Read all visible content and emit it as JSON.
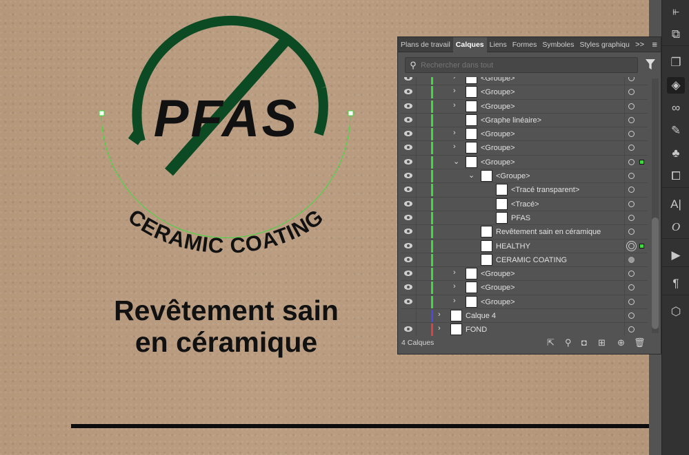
{
  "artwork": {
    "logo_text": "PFAS",
    "arc_text": "CERAMIC COATING",
    "headline_line1": "Revêtement sain",
    "headline_line2": "en céramique",
    "brand_green": "#0b4a23",
    "selection_color": "#3ddc3d"
  },
  "panel": {
    "tabs": [
      {
        "label": "Plans de travail"
      },
      {
        "label": "Calques",
        "active": true
      },
      {
        "label": "Liens"
      },
      {
        "label": "Formes"
      },
      {
        "label": "Symboles"
      },
      {
        "label": "Styles graphiqu"
      }
    ],
    "more_label": ">>",
    "search_placeholder": "Rechercher dans tout",
    "layers": [
      {
        "name": "<Groupe>",
        "level": 1,
        "expander": "collapsed",
        "visible": true,
        "color": "#3ddc3d"
      },
      {
        "name": "<Groupe>",
        "level": 1,
        "expander": "collapsed",
        "visible": true,
        "color": "#3ddc3d"
      },
      {
        "name": "<Groupe>",
        "level": 1,
        "expander": "collapsed",
        "visible": true,
        "color": "#3ddc3d"
      },
      {
        "name": "<Graphe linéaire>",
        "level": 1,
        "expander": "none",
        "visible": true,
        "color": "#3ddc3d"
      },
      {
        "name": "<Groupe>",
        "level": 1,
        "expander": "collapsed",
        "visible": true,
        "color": "#3ddc3d"
      },
      {
        "name": "<Groupe>",
        "level": 1,
        "expander": "collapsed",
        "visible": true,
        "color": "#3ddc3d"
      },
      {
        "name": "<Groupe>",
        "level": 1,
        "expander": "expanded",
        "visible": true,
        "color": "#3ddc3d",
        "selected": true
      },
      {
        "name": "<Groupe>",
        "level": 2,
        "expander": "expanded",
        "visible": true,
        "color": "#3ddc3d"
      },
      {
        "name": "<Tracé transparent>",
        "level": 3,
        "expander": "none",
        "visible": true,
        "color": "#3ddc3d"
      },
      {
        "name": "<Tracé>",
        "level": 3,
        "expander": "none",
        "visible": true,
        "color": "#3ddc3d"
      },
      {
        "name": "PFAS",
        "level": 3,
        "expander": "none",
        "visible": true,
        "color": "#3ddc3d"
      },
      {
        "name": "Revêtement sain en céramique",
        "level": 2,
        "expander": "none",
        "visible": true,
        "color": "#3ddc3d"
      },
      {
        "name": "HEALTHY",
        "level": 2,
        "expander": "none",
        "visible": true,
        "color": "#3ddc3d",
        "target": "double",
        "selected": true
      },
      {
        "name": "CERAMIC COATING",
        "level": 2,
        "expander": "none",
        "visible": true,
        "color": "#3ddc3d",
        "target": "filled"
      },
      {
        "name": "<Groupe>",
        "level": 1,
        "expander": "collapsed",
        "visible": true,
        "color": "#3ddc3d"
      },
      {
        "name": "<Groupe>",
        "level": 1,
        "expander": "collapsed",
        "visible": true,
        "color": "#3ddc3d"
      },
      {
        "name": "<Groupe>",
        "level": 1,
        "expander": "collapsed",
        "visible": true,
        "color": "#3ddc3d"
      },
      {
        "name": "Calque 4",
        "level": 0,
        "expander": "collapsed",
        "visible": false,
        "color": "#4a4ae0"
      },
      {
        "name": "FOND",
        "level": 0,
        "expander": "collapsed",
        "visible": true,
        "color": "#e04040"
      }
    ],
    "footer_count": "4 Calques"
  },
  "toolbar": {
    "icons": [
      "align-icon",
      "pathfinder-icon",
      "artboards-icon",
      "layers-icon",
      "links-icon",
      "brushes-icon",
      "symbols-icon",
      "transform-icon",
      "character-icon",
      "opentype-icon",
      "actions-icon",
      "paragraph-icon",
      "3d-icon"
    ]
  }
}
